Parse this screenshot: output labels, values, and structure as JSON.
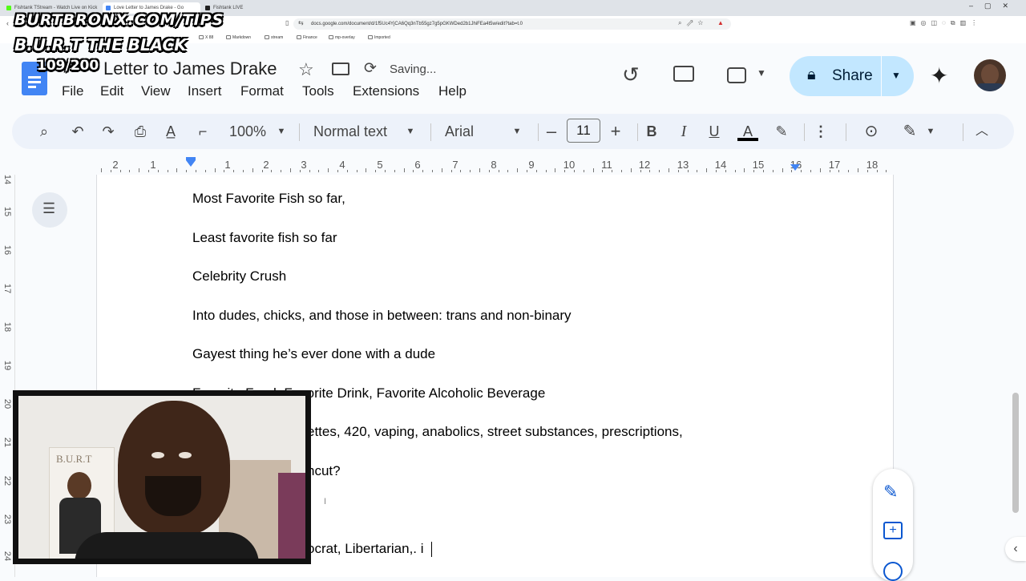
{
  "browser": {
    "tabs": [
      {
        "label": "Fishtank TStream - Watch Live on Kick",
        "active": false,
        "color": "#53fc18"
      },
      {
        "label": "Love Letter to James Drake - Go",
        "active": true,
        "color": "#4285f4"
      },
      {
        "label": "Fishtank LIVE",
        "active": false,
        "color": "#222222"
      }
    ],
    "url": "docs.google.com/document/d/1f5Uc4YjCA6Qq3nTb55gz7g5pGKWDed2b1JhiFEa4t5w/edit?tab=t.0",
    "bookmarks": [
      "X 88",
      "Markdown",
      "stream",
      "Finance",
      "mp-overlay",
      "Imported"
    ]
  },
  "doc": {
    "title": "Letter to James Drake",
    "status": "Saving...",
    "menu": [
      "File",
      "Edit",
      "View",
      "Insert",
      "Format",
      "Tools",
      "Extensions",
      "Help"
    ],
    "share_label": "Share"
  },
  "toolbar": {
    "zoom": "100%",
    "style": "Normal text",
    "font": "Arial",
    "font_size": "11",
    "minus": "–",
    "plus": "+",
    "bold": "B",
    "italic": "I",
    "underline": "U",
    "text_color": "A",
    "text_color_value": "#000000",
    "more": "⋮"
  },
  "ruler": {
    "numbers": [
      "2",
      "1",
      "1",
      "2",
      "3",
      "4",
      "5",
      "6",
      "7",
      "8",
      "9",
      "10",
      "11",
      "12",
      "13",
      "14",
      "15",
      "16",
      "17",
      "18"
    ]
  },
  "vruler": {
    "numbers": [
      "14",
      "15",
      "16",
      "17",
      "18",
      "19",
      "20",
      "21",
      "22",
      "23",
      "24"
    ]
  },
  "body": {
    "lines": [
      "Most Favorite Fish so far,",
      "Least favorite fish so far",
      "Celebrity Crush",
      "Into dudes, chicks, and those in between: trans and non-binary",
      "Gayest thing he’s ever done with a dude",
      "Favorite Food, Favorite Drink, Favorite Alcoholic Beverage",
      "ettes, 420, vaping, anabolics, street substances, prescriptions,",
      "ncut?",
      "ocrat, Libertarian,. i"
    ],
    "line6_visible": "avorite Drink, Favorite Alcoholic Beverage",
    "line6_partial": "Favorite Food, F"
  },
  "overlay": {
    "site": "BURTBRONX.COM/TIPS",
    "name": "B.U.R.T THE BLACK",
    "counter": "109/200",
    "poster_text": "B.U.R.T"
  },
  "colors": {
    "share_bg": "#c2e7ff",
    "accent": "#4285f4",
    "toolbar_bg": "#edf2fa"
  }
}
